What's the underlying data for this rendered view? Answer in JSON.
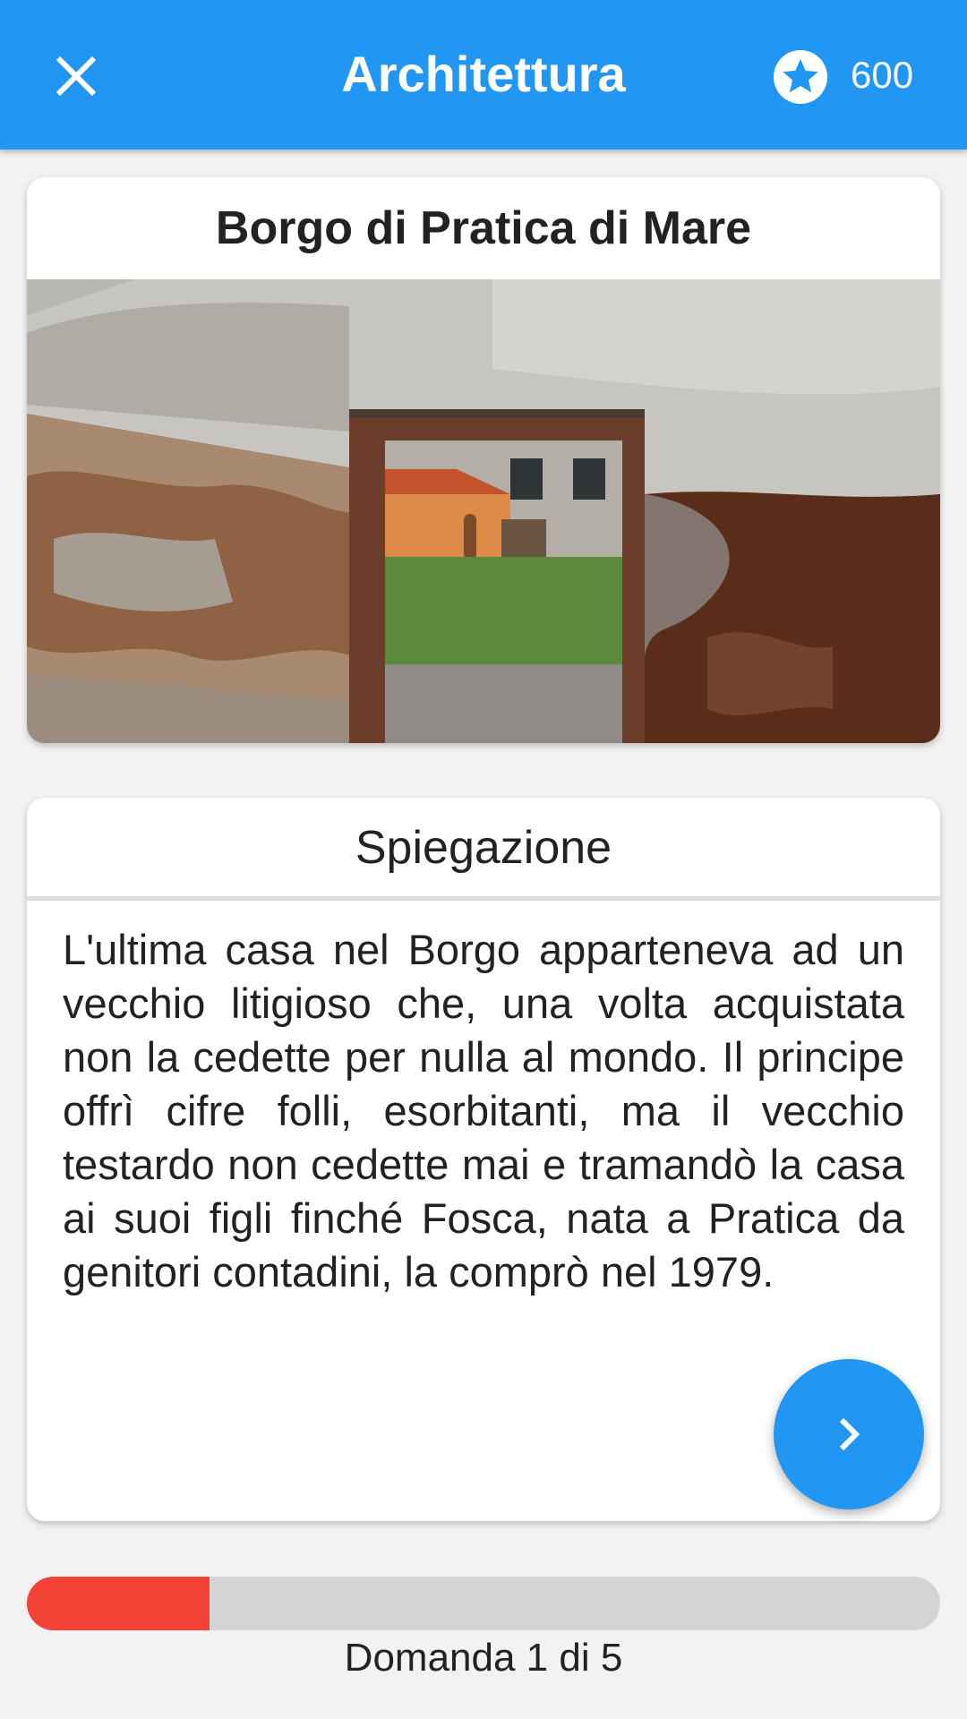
{
  "appbar": {
    "title": "Architettura",
    "score": "600",
    "close_icon": "close-icon",
    "score_icon": "star-circle-icon"
  },
  "photo_card": {
    "title": "Borgo di Pratica di Mare",
    "image": "photo of a ruined weathered wall with a doorway opening onto an orange house and a green lawn"
  },
  "explanation": {
    "title": "Spiegazione",
    "text": "L'ultima casa nel Borgo apparteneva ad un vecchio litigioso che, una volta acquistata non la cedette per nulla al mondo. Il principe offrì cifre folli, esorbitanti, ma il vecchio testardo non cedette mai e tramandò la casa ai suoi figli finché Fosca, nata a Pratica da genitori contadini, la comprò nel 1979."
  },
  "next_button": {
    "icon": "chevron-right-icon"
  },
  "progress": {
    "current": 1,
    "total": 5,
    "fraction": 0.2,
    "label": "Domanda 1 di 5"
  },
  "colors": {
    "primary": "#2196f3",
    "progress_fill": "#f44336",
    "progress_track": "#d4d4d4",
    "background": "#f2f2f2"
  }
}
